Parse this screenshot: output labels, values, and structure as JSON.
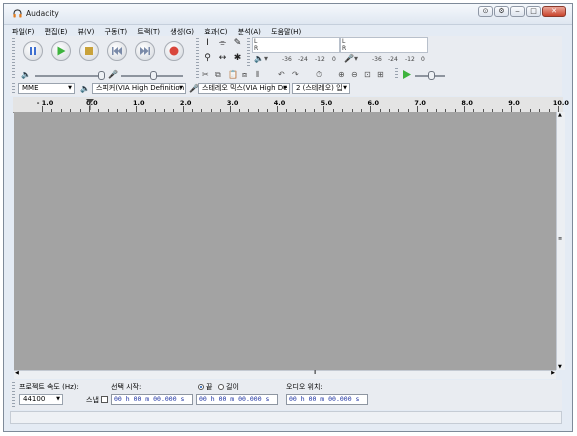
{
  "window": {
    "title": "Audacity"
  },
  "menu": [
    "파일(F)",
    "편집(E)",
    "뷰(V)",
    "구동(T)",
    "트랙(T)",
    "생성(G)",
    "효과(C)",
    "분석(A)",
    "도움말(H)"
  ],
  "meters": {
    "playback_L": "L",
    "playback_R": "R",
    "record_L": "L",
    "record_R": "R",
    "scale_playback": [
      "-36",
      "-24",
      "-12",
      "0"
    ],
    "scale_record": [
      "-36",
      "-24",
      "-12",
      "0"
    ]
  },
  "devices": {
    "host": "MME",
    "output": "스피커(VIA High Definition",
    "input": "스테레오 믹스(VIA High De",
    "channels": "2 (스테레오) 입"
  },
  "ruler": {
    "ticks": [
      "- 1.0",
      "0.0",
      "1.0",
      "2.0",
      "3.0",
      "4.0",
      "5.0",
      "6.0",
      "7.0",
      "8.0",
      "9.0",
      "10.0"
    ]
  },
  "selection": {
    "project_rate_label": "프로젝트 속도 (Hz):",
    "project_rate_value": "44100",
    "snap_label": "스냅",
    "selection_start_label": "선택 시작:",
    "end_label": "끝",
    "length_label": "길이",
    "audio_position_label": "오디오 위치:",
    "start_time": "00 h 00 m 00.000 s",
    "end_time": "00 h 00 m 00.000 s",
    "audio_time": "00 h 00 m 00.000 s"
  },
  "colors": {
    "track_bg": "#a3a3a3",
    "play_green": "#3db33d",
    "record_red": "#d9463b",
    "pause_blue": "#3e6fd0"
  }
}
